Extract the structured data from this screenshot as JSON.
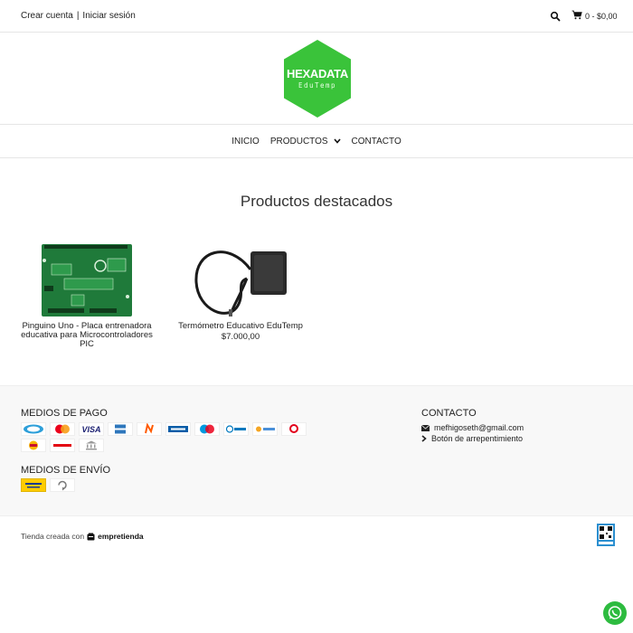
{
  "topbar": {
    "create_account": "Crear cuenta",
    "separator": "|",
    "login": "Iniciar sesión",
    "cart_summary": "0 - $0,00"
  },
  "logo": {
    "title": "HEXADATA",
    "subtitle": "EduTemp",
    "color": "#3ac33a"
  },
  "nav": {
    "items": [
      "INICIO",
      "PRODUCTOS",
      "CONTACTO"
    ]
  },
  "featured": {
    "title": "Productos destacados",
    "products": [
      {
        "name": "Pinguino Uno - Placa entrenadora educativa para Microcontroladores PIC",
        "price": ""
      },
      {
        "name": "Termómetro Educativo EduTemp",
        "price": "$7.000,00"
      }
    ]
  },
  "footer": {
    "payment_title": "MEDIOS DE PAGO",
    "payment_methods": [
      "mercado-pago",
      "mastercard",
      "visa",
      "amex",
      "naranja",
      "cabal",
      "maestro",
      "diners-club",
      "nativa",
      "argencard",
      "tarjeta-shopping",
      "rapipago",
      "transferencia-bancaria"
    ],
    "shipping_title": "MEDIOS DE ENVÍO",
    "shipping_methods": [
      "correo-argentino",
      "envio-a-convenir"
    ],
    "contact_title": "CONTACTO",
    "email": "mefhigoseth@gmail.com",
    "withdrawal_button": "Botón de arrepentimiento"
  },
  "bottom": {
    "created_with": "Tienda creada con",
    "platform": "empretienda"
  }
}
